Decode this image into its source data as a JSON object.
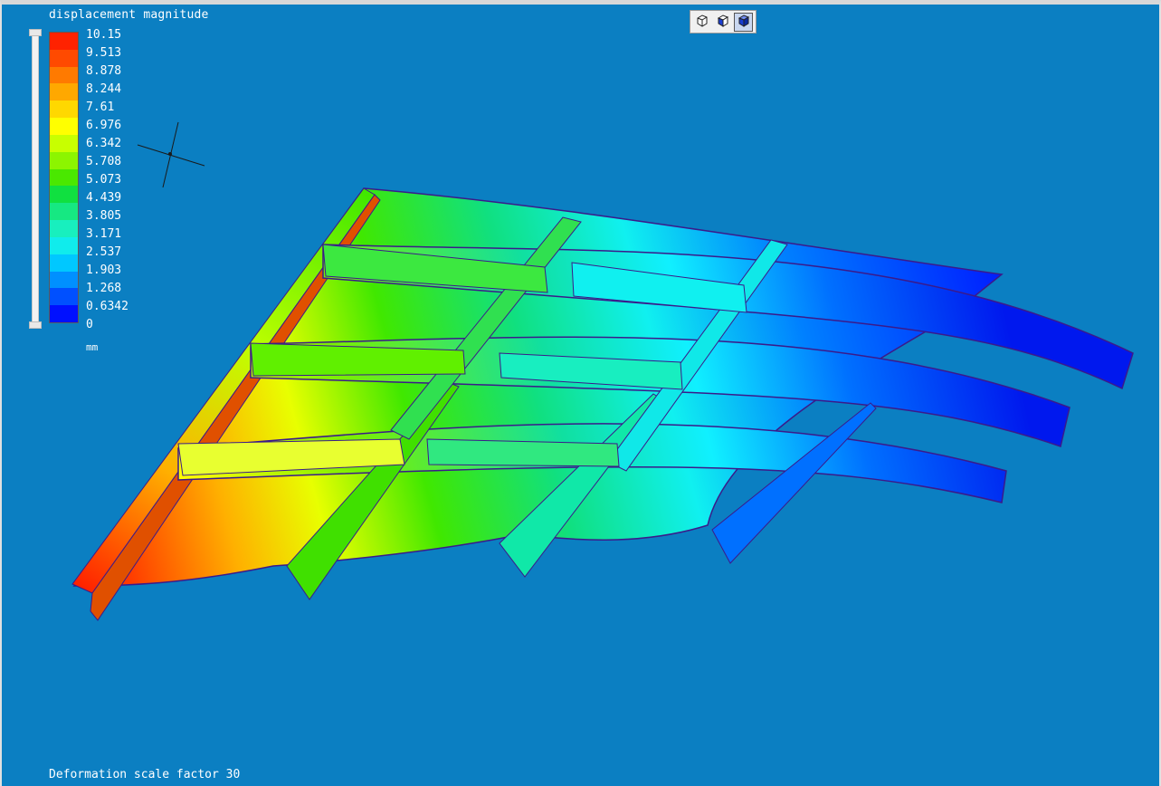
{
  "legend": {
    "title": "displacement magnitude",
    "unit": "mm",
    "ticks": [
      "10.15",
      "9.513",
      "8.878",
      "8.244",
      "7.61",
      "6.976",
      "6.342",
      "5.708",
      "5.073",
      "4.439",
      "3.805",
      "3.171",
      "2.537",
      "1.903",
      "1.268",
      "0.6342",
      "0"
    ],
    "colors": [
      "#ff2200",
      "#ff4a00",
      "#ff7a00",
      "#ffa800",
      "#ffd800",
      "#ffff00",
      "#c8ff00",
      "#8cf500",
      "#4ae800",
      "#10e040",
      "#16e882",
      "#18efbe",
      "#10ecec",
      "#00c8ff",
      "#0090ff",
      "#0050ff",
      "#0010ff"
    ]
  },
  "toolbar": {
    "buttons": [
      {
        "icon": "wireframe-cube-icon",
        "active": false
      },
      {
        "icon": "shaded-cube-icon",
        "active": false
      },
      {
        "icon": "solid-cube-icon",
        "active": true
      }
    ]
  },
  "footer": {
    "deformation_label": "Deformation scale factor 30"
  },
  "viewport": {
    "background": "#0b7fc2"
  }
}
